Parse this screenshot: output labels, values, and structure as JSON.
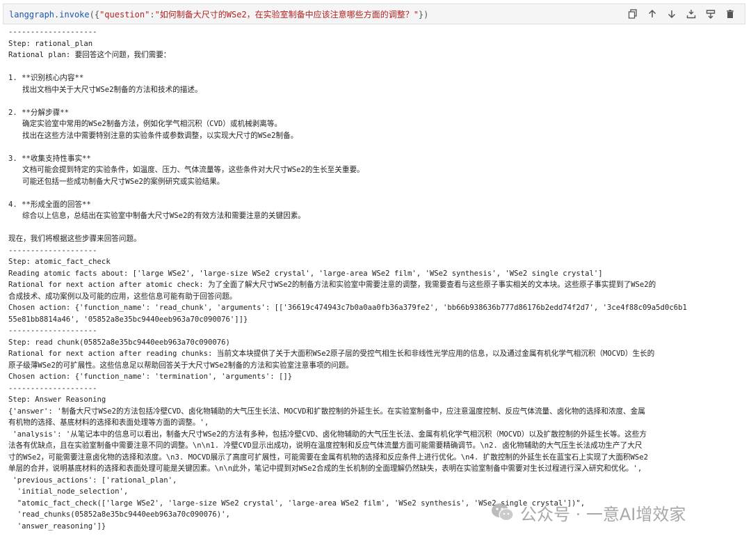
{
  "cell": {
    "code_fn": "langgraph",
    "code_dot": ".",
    "code_method": "invoke",
    "code_open": "({",
    "code_key": "\"question\"",
    "code_colon": ":",
    "code_value": "\"如何制备大尺寸的WSe2，在实验室制备中应该注意哪些方面的调整？\"",
    "code_close": "})"
  },
  "output": {
    "lines": [
      {
        "text": "--------------------",
        "kind": "line"
      },
      {
        "text": "Step: rational_plan",
        "kind": "line"
      },
      {
        "text": "Rational plan: 要回答这个问题，我们需要：",
        "kind": "line"
      },
      {
        "text": "",
        "kind": "blank"
      },
      {
        "text": "1. **识别核心内容**",
        "kind": "line"
      },
      {
        "text": "找出文档中关于大尺寸WSe2制备的方法和技术的描述。",
        "kind": "indent"
      },
      {
        "text": "",
        "kind": "blank"
      },
      {
        "text": "2. **分解步骤**",
        "kind": "line"
      },
      {
        "text": "确定实验室中常用的WSe2制备方法，例如化学气相沉积（CVD）或机械剥离等。",
        "kind": "indent"
      },
      {
        "text": "找出在这些方法中需要特别注意的实验条件或参数调整，以实现大尺寸的WSe2制备。",
        "kind": "indent"
      },
      {
        "text": "",
        "kind": "blank"
      },
      {
        "text": "3. **收集支持性事实**",
        "kind": "line"
      },
      {
        "text": "文档可能会提到特定的实验条件，如温度、压力、气体流量等，这些条件对大尺寸WSe2的生长至关重要。",
        "kind": "indent"
      },
      {
        "text": "可能还包括一些成功制备大尺寸WSe2的案例研究或实验结果。",
        "kind": "indent"
      },
      {
        "text": "",
        "kind": "blank"
      },
      {
        "text": "4. **形成全面的回答**",
        "kind": "line"
      },
      {
        "text": "综合以上信息，总结出在实验室中制备大尺寸WSe2的有效方法和需要注意的关键因素。",
        "kind": "indent"
      },
      {
        "text": "",
        "kind": "blank"
      },
      {
        "text": "现在，我们将根据这些步骤来回答问题。",
        "kind": "line"
      },
      {
        "text": "--------------------",
        "kind": "line"
      },
      {
        "text": "Step: atomic_fact_check",
        "kind": "line"
      },
      {
        "text": "Reading atomic facts about: ['large WSe2', 'large-size WSe2 crystal', 'large-area WSe2 film', 'WSe2 synthesis', 'WSe2 single crystal']",
        "kind": "line"
      },
      {
        "text": "Rational for next action after atomic check: 为了全面了解大尺寸WSe2的制备方法和实验室中需要注意的调整，我需要查看与这些原子事实相关的文本块。这些原子事实提到了WSe2的",
        "kind": "line"
      },
      {
        "text": "合成技术、成功案例以及可能的应用，这些信息可能有助于回答问题。",
        "kind": "line"
      },
      {
        "text": "Chosen action: {'function_name': 'read_chunk', 'arguments': [['36619c474943c7b0a0aa0fb36a379fe2', 'bb66b938636b777d86176b2edd74f2d7', '3ce4f88c09a5d0c6b1",
        "kind": "line"
      },
      {
        "text": "55e81bb8814a46', '05852a8e35bc9440eeb963a70c090076']]}",
        "kind": "line"
      },
      {
        "text": "--------------------",
        "kind": "line"
      },
      {
        "text": "Step: read chunk(05852a8e35bc9440eeb963a70c090076)",
        "kind": "line"
      },
      {
        "text": "Rational for next action after reading chunks: 当前文本块提供了关于大面积WSe2原子层的受控气相生长和非线性光学应用的信息，以及通过金属有机化学气相沉积（MOCVD）生长的",
        "kind": "line"
      },
      {
        "text": "原子级薄WSe2的可扩展性。这些信息足以帮助回答关于大尺寸WSe2制备的方法和实验室注意事项的问题。",
        "kind": "line"
      },
      {
        "text": "Chosen action: {'function_name': 'termination', 'arguments': []}",
        "kind": "line"
      },
      {
        "text": "--------------------",
        "kind": "line"
      },
      {
        "text": "Step: Answer Reasoning",
        "kind": "line"
      },
      {
        "text": "{'answer': '制备大尺寸WSe2的方法包括冷壁CVD、卤化物辅助的大气压生长法、MOCVD和扩散控制的外延生长。在实验室制备中，应注意温度控制、反应气体流量、卤化物的选择和浓度、金属",
        "kind": "line"
      },
      {
        "text": "有机物的选择、基底材料的选择和表面处理等方面的调整。',",
        "kind": "line"
      },
      {
        "text": " 'analysis': '从笔记本中的信息可以看出，制备大尺寸WSe2的方法有多种，包括冷壁CVD、卤化物辅助的大气压生长法、金属有机化学气相沉积（MOCVD）以及扩散控制的外延生长等。这些方",
        "kind": "line"
      },
      {
        "text": "法各有优缺点，且在实验室制备中需要注意不同的调整。\\n\\n1. 冷壁CVD显示出成功，说明在温度控制和反应气体流量方面可能需要精确调节。\\n2. 卤化物辅助的大气压生长法成功生产了大尺",
        "kind": "line"
      },
      {
        "text": "寸的WSe2，可能需要注意卤化物的选择和浓度。\\n3. MOCVD展示了高度可扩展性，可能需要在金属有机物的选择和反应条件上进行优化。\\n4. 扩散控制的外延生长在蓝宝石上实现了大面积WSe2",
        "kind": "line"
      },
      {
        "text": "单层的合并，说明基底材料的选择和表面处理可能是关键因素。\\n\\n此外，笔记中提到对WSe2合成的生长机制的全面理解仍然缺失，表明在实验室制备中需要对生长过程进行深入研究和优化。',",
        "kind": "line"
      },
      {
        "text": " 'previous_actions': ['rational_plan',",
        "kind": "line"
      },
      {
        "text": "  'initial_node_selection',",
        "kind": "line"
      },
      {
        "text": "  \"atomic_fact_check(['large WSe2', 'large-size WSe2 crystal', 'large-area WSe2 film', 'WSe2 synthesis', 'WSe2 single crystal'])\",",
        "kind": "line"
      },
      {
        "text": "  'read_chunks(05852a8e35bc9440eeb963a70c090076)',",
        "kind": "line"
      },
      {
        "text": "  'answer_reasoning']}",
        "kind": "line"
      }
    ]
  },
  "watermark": {
    "text": "公众号 · 一意AI增效家",
    "icon": "wechat-logo-icon"
  },
  "toolbar_icons": [
    "copy-icon",
    "arrow-up-icon",
    "arrow-down-icon",
    "insert-below-icon",
    "split-cell-icon",
    "delete-icon"
  ],
  "colors": {
    "cell_bg": "#f5f5f5",
    "string": "#b22222",
    "function": "#1a56b3"
  }
}
